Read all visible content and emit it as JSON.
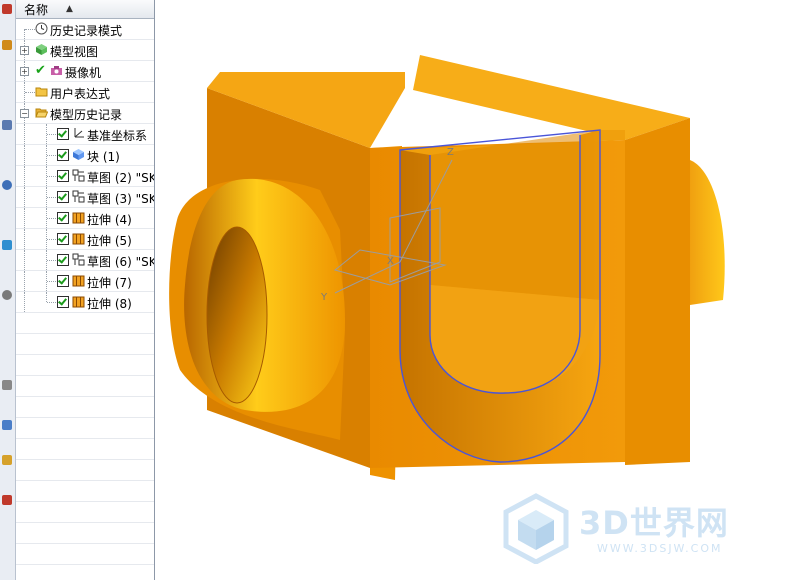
{
  "navigator": {
    "header": {
      "name_col": "名称",
      "sort_icon": "triangle-up-icon"
    },
    "items": [
      {
        "label": "历史记录模式",
        "icon": "clock-icon",
        "indent": 0,
        "expander": null,
        "checkbox": false
      },
      {
        "label": "模型视图",
        "icon": "cube-view-icon",
        "indent": 0,
        "expander": "+",
        "checkbox": false
      },
      {
        "label": "摄像机",
        "icon": "camera-icon",
        "indent": 0,
        "expander": "+",
        "checkbox": false,
        "check_mark": true
      },
      {
        "label": "用户表达式",
        "icon": "folder-icon",
        "indent": 0,
        "expander": null,
        "checkbox": false
      },
      {
        "label": "模型历史记录",
        "icon": "folder-open-icon",
        "indent": 0,
        "expander": "-",
        "checkbox": false
      },
      {
        "label": "基准坐标系",
        "icon": "datum-csys-icon",
        "indent": 1,
        "checkbox": true
      },
      {
        "label": "块 (1)",
        "icon": "block-icon",
        "indent": 1,
        "checkbox": true
      },
      {
        "label": "草图 (2) \"SK",
        "icon": "sketch-icon",
        "indent": 1,
        "checkbox": true
      },
      {
        "label": "草图 (3) \"SK",
        "icon": "sketch-icon",
        "indent": 1,
        "checkbox": true
      },
      {
        "label": "拉伸 (4)",
        "icon": "extrude-icon",
        "indent": 1,
        "checkbox": true
      },
      {
        "label": "拉伸 (5)",
        "icon": "extrude-icon",
        "indent": 1,
        "checkbox": true
      },
      {
        "label": "草图 (6) \"SK",
        "icon": "sketch-icon",
        "indent": 1,
        "checkbox": true
      },
      {
        "label": "拉伸 (7)",
        "icon": "extrude-icon",
        "indent": 1,
        "checkbox": true
      },
      {
        "label": "拉伸 (8)",
        "icon": "extrude-icon",
        "indent": 1,
        "checkbox": true
      }
    ]
  },
  "viewport": {
    "axis_labels": {
      "z": "Z",
      "x": "X",
      "y": "Y"
    },
    "model_color": "#f29a0a",
    "edge_highlight_color": "#4a55d8"
  },
  "watermark": {
    "brand": "3D世界网",
    "url": "WWW.3DSJW.COM"
  }
}
